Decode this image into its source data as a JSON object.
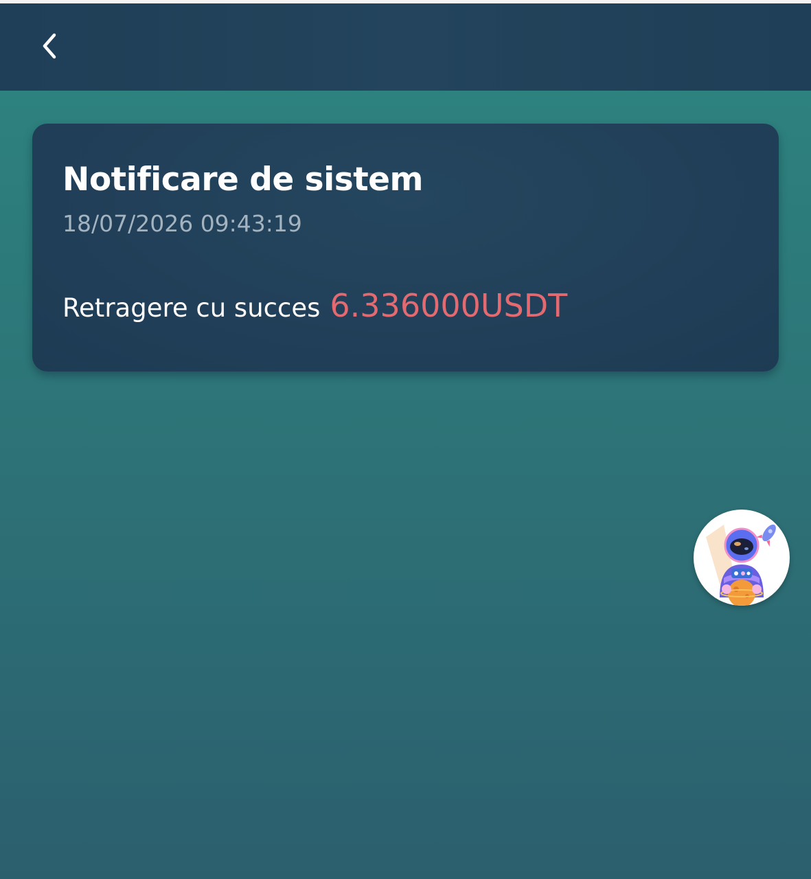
{
  "header": {
    "back_icon": "chevron-left-icon"
  },
  "notification": {
    "title": "Notificare de sistem",
    "datetime": "18/07/2026 09:43:19",
    "message_text": "Retragere cu succes",
    "amount": "6.336000USDT"
  },
  "support": {
    "avatar_icon": "astronaut-avatar-icon"
  },
  "colors": {
    "background_top": "#2d8580",
    "background_bottom": "#2c5f6e",
    "header": "#1f3e57",
    "card": "#213f58",
    "amount": "#e26a70",
    "timestamp": "#a3b3bf"
  }
}
